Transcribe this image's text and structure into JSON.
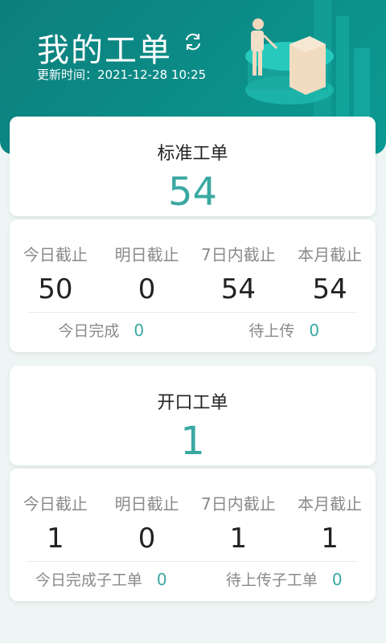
{
  "header": {
    "title": "我的工单",
    "update_label": "更新时间：2021-12-28 10:25"
  },
  "sections": [
    {
      "title": "标准工单",
      "count": "54",
      "stats": [
        {
          "label": "今日截止",
          "value": "50"
        },
        {
          "label": "明日截止",
          "value": "0"
        },
        {
          "label": "7日内截止",
          "value": "54"
        },
        {
          "label": "本月截止",
          "value": "54"
        }
      ],
      "footer": [
        {
          "label": "今日完成",
          "value": "0"
        },
        {
          "label": "待上传",
          "value": "0"
        }
      ]
    },
    {
      "title": "开口工单",
      "count": "1",
      "stats": [
        {
          "label": "今日截止",
          "value": "1"
        },
        {
          "label": "明日截止",
          "value": "0"
        },
        {
          "label": "7日内截止",
          "value": "1"
        },
        {
          "label": "本月截止",
          "value": "1"
        }
      ],
      "footer": [
        {
          "label": "今日完成子工单",
          "value": "0"
        },
        {
          "label": "待上传子工单",
          "value": "0"
        }
      ]
    }
  ],
  "colors": {
    "accent": "#3aa8a2",
    "header_bg": "#0d8a85"
  },
  "icons": [
    "refresh-icon",
    "header-illustration"
  ]
}
